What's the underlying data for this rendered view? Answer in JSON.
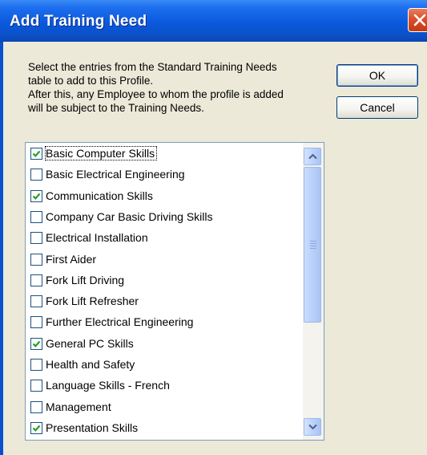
{
  "window": {
    "title": "Add Training Need",
    "close_icon": "close-x-icon"
  },
  "instructions": {
    "line1": "Select the entries from the Standard Training Needs",
    "line2": "table to add to this Profile.",
    "line3": "After this, any Employee to whom the profile is added",
    "line4": "will be subject to the Training Needs."
  },
  "buttons": {
    "ok": "OK",
    "cancel": "Cancel"
  },
  "list": {
    "items": [
      {
        "label": "Basic Computer Skills",
        "checked": true
      },
      {
        "label": "Basic Electrical Engineering",
        "checked": false
      },
      {
        "label": "Communication Skills",
        "checked": true
      },
      {
        "label": "Company Car Basic Driving Skills",
        "checked": false
      },
      {
        "label": "Electrical Installation",
        "checked": false
      },
      {
        "label": "First Aider",
        "checked": false
      },
      {
        "label": "Fork Lift Driving",
        "checked": false
      },
      {
        "label": "Fork Lift Refresher",
        "checked": false
      },
      {
        "label": "Further Electrical Engineering",
        "checked": false
      },
      {
        "label": "General PC Skills",
        "checked": true
      },
      {
        "label": "Health and Safety",
        "checked": false
      },
      {
        "label": "Language Skills - French",
        "checked": false
      },
      {
        "label": "Management",
        "checked": false
      },
      {
        "label": "Presentation Skills",
        "checked": true
      }
    ],
    "scroll_up_icon": "scroll-up-arrow-icon",
    "scroll_down_icon": "scroll-down-arrow-icon"
  },
  "colors": {
    "titlebar": "#0a59dc",
    "dialog_bg": "#ece9d8",
    "checkmark": "#21a121"
  }
}
